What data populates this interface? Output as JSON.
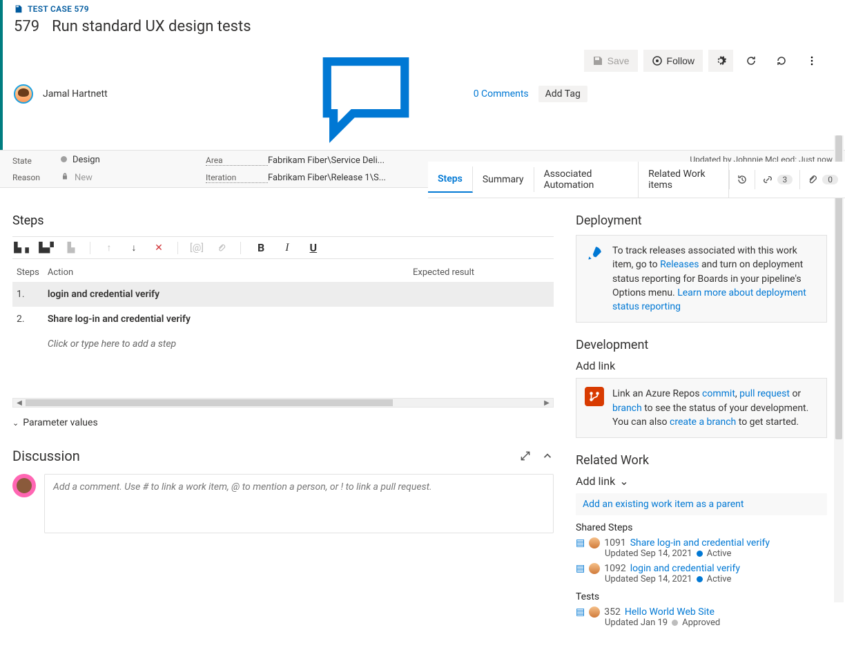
{
  "header": {
    "crumb": "TEST CASE 579",
    "id": "579",
    "title": "Run standard UX design tests",
    "assignee": "Jamal Hartnett",
    "comments_label": "0 Comments",
    "add_tag_label": "Add Tag",
    "save_label": "Save",
    "follow_label": "Follow",
    "updated_text": "Updated by Johnnie McLeod: Just now"
  },
  "fields": {
    "state_label": "State",
    "state_value": "Design",
    "reason_label": "Reason",
    "reason_value": "New",
    "area_label": "Area",
    "area_value": "Fabrikam Fiber\\Service Deli...",
    "iteration_label": "Iteration",
    "iteration_value": "Fabrikam Fiber\\Release 1\\S..."
  },
  "tabs": {
    "items": [
      "Steps",
      "Summary",
      "Associated Automation",
      "Related Work items"
    ],
    "active_index": 0,
    "links_count": "3",
    "attachments_count": "0"
  },
  "steps": {
    "section_title": "Steps",
    "col_step": "Steps",
    "col_action": "Action",
    "col_expected": "Expected result",
    "rows": [
      {
        "n": "1.",
        "action": "login and credential verify",
        "expected": ""
      },
      {
        "n": "2.",
        "action": "Share log-in and credential verify",
        "expected": ""
      }
    ],
    "add_step_placeholder": "Click or type here to add a step",
    "param_values_label": "Parameter values"
  },
  "discussion": {
    "title": "Discussion",
    "placeholder": "Add a comment. Use # to link a work item, @ to mention a person, or ! to link a pull request."
  },
  "deployment": {
    "title": "Deployment",
    "text_pre": "To track releases associated with this work item, go to ",
    "link1": "Releases",
    "text_mid": " and turn on deployment status reporting for Boards in your pipeline's Options menu. ",
    "link2": "Learn more about deployment status reporting"
  },
  "development": {
    "title": "Development",
    "add_link_label": "Add link",
    "text_a": "Link an Azure Repos ",
    "link_commit": "commit",
    "link_pr": "pull request",
    "text_b": " or ",
    "link_branch": "branch",
    "text_c": " to see the status of your development. You can also ",
    "link_create": "create a branch",
    "text_d": " to get started."
  },
  "related": {
    "title": "Related Work",
    "add_link_label": "Add link",
    "add_parent_label": "Add an existing work item as a parent",
    "groups": [
      {
        "name": "Shared Steps",
        "icon": "shared-steps-icon",
        "items": [
          {
            "id": "1091",
            "title": "Share log-in and credential verify",
            "updated": "Updated Sep 14, 2021",
            "state": "Active",
            "state_class": "active"
          },
          {
            "id": "1092",
            "title": "login and credential verify",
            "updated": "Updated Sep 14, 2021",
            "state": "Active",
            "state_class": "active"
          }
        ]
      },
      {
        "name": "Tests",
        "icon": "test-plan-icon",
        "items": [
          {
            "id": "352",
            "title": "Hello World Web Site",
            "updated": "Updated Jan 19",
            "state": "Approved",
            "state_class": "approved"
          }
        ]
      }
    ]
  }
}
